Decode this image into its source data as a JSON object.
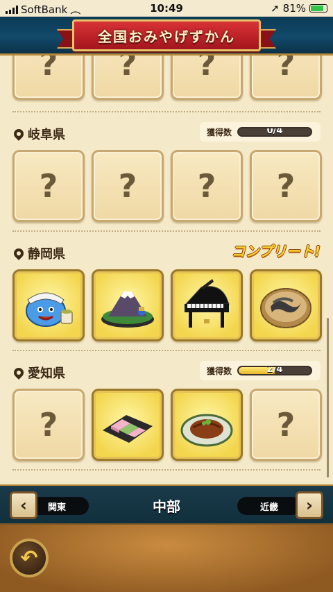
{
  "status_bar": {
    "carrier": "SoftBank",
    "time": "10:49",
    "battery": "81%",
    "battery_level": 0.81
  },
  "header": {
    "title": "全国おみやげずかん"
  },
  "placeholder_mark": "?",
  "sections": [
    {
      "name": "岐阜県",
      "count_label": "獲得数",
      "count": "0/4",
      "progress": 0.0
    },
    {
      "name": "静岡県",
      "badge": "コンプリート!"
    },
    {
      "name": "愛知県",
      "count_label": "獲得数",
      "count": "2/4",
      "progress": 0.5
    }
  ],
  "region_nav": {
    "prev_arrow": "‹",
    "next_arrow": "›",
    "prev_label": "関東",
    "current": "中部",
    "next_label": "近畿"
  },
  "footer": {
    "back_glyph": "↶"
  },
  "colors": {
    "header_blue": "#0c3a55",
    "banner_red": "#c62a2e",
    "parchment": "#f4e9c8",
    "gold": "#f3d64d"
  }
}
